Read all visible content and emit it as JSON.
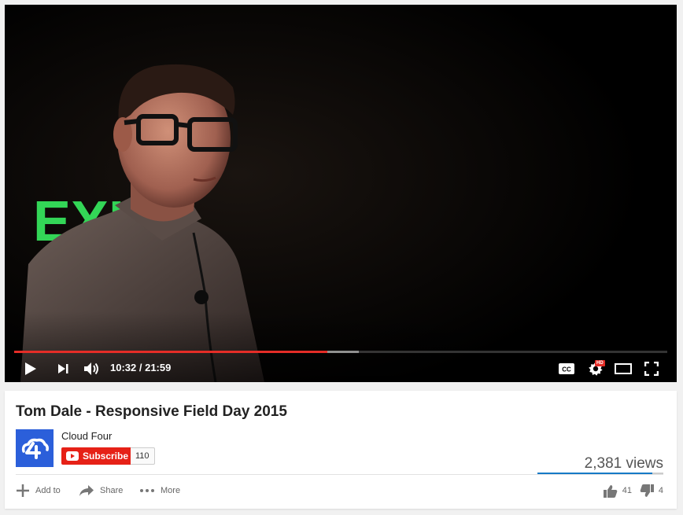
{
  "player": {
    "current_time": "10:32",
    "duration": "21:59",
    "played_fraction": 0.48,
    "loaded_fraction": 0.528,
    "colors": {
      "progress_played": "#e52d27",
      "hd_badge": "#e52d27"
    },
    "scene_sign": "EXIT",
    "icons": [
      "play-icon",
      "next-icon",
      "volume-icon",
      "captions-icon",
      "settings-icon",
      "theater-mode-icon",
      "fullscreen-icon"
    ],
    "captions_label": "CC",
    "hd_label": "HD"
  },
  "video": {
    "title": "Tom Dale - Responsive Field Day 2015",
    "channel": "Cloud Four",
    "subscribe_label": "Subscribe",
    "subscriber_count": "110",
    "views": "2,381 views",
    "like_fraction": 0.91
  },
  "actions": {
    "add_to": "Add to",
    "share": "Share",
    "more": "More",
    "likes": "41",
    "dislikes": "4"
  },
  "colors": {
    "brand_red": "#e62117",
    "channel_avatar": "#2b5fda",
    "like_bar": "#167ac6"
  }
}
